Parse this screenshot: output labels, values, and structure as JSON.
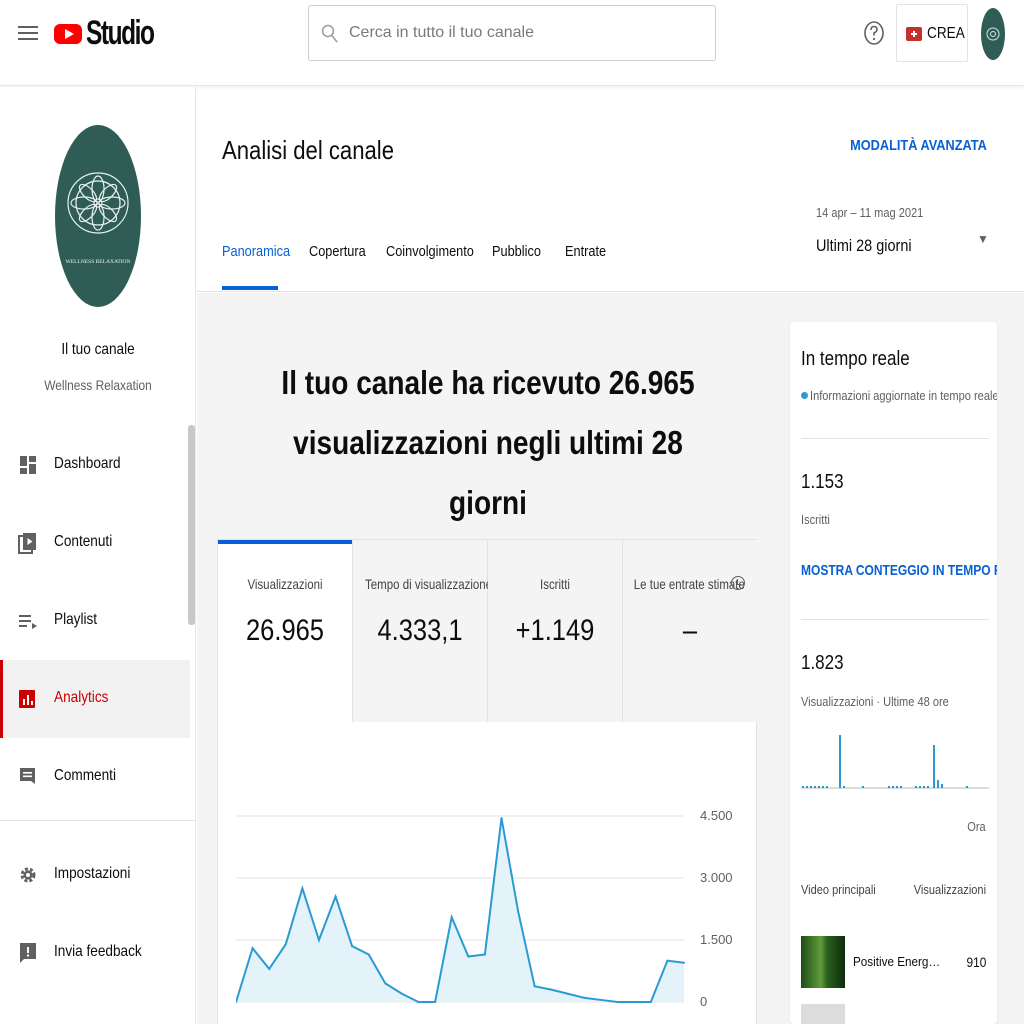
{
  "header": {
    "logo_text": "Studio",
    "search_placeholder": "Cerca in tutto il tuo canale",
    "create_label": "CREA"
  },
  "sidebar": {
    "channel_title": "Il tuo canale",
    "channel_name": "Wellness Relaxation",
    "avatar_text": "WELLNESS RELAXATION",
    "items": [
      {
        "label": "Dashboard",
        "icon": "dashboard-icon"
      },
      {
        "label": "Contenuti",
        "icon": "content-icon"
      },
      {
        "label": "Playlist",
        "icon": "playlist-icon"
      },
      {
        "label": "Analytics",
        "icon": "analytics-icon",
        "active": true
      },
      {
        "label": "Commenti",
        "icon": "comments-icon"
      }
    ],
    "bottom_items": [
      {
        "label": "Impostazioni",
        "icon": "gear-icon"
      },
      {
        "label": "Invia feedback",
        "icon": "feedback-icon"
      }
    ]
  },
  "main": {
    "title": "Analisi del canale",
    "advanced_link": "MODALITÀ AVANZATA",
    "tabs": [
      {
        "label": "Panoramica",
        "active": true
      },
      {
        "label": "Copertura"
      },
      {
        "label": "Coinvolgimento"
      },
      {
        "label": "Pubblico"
      },
      {
        "label": "Entrate"
      }
    ],
    "date_range": "14 apr – 11 mag 2021",
    "period_selected": "Ultimi 28 giorni",
    "headline": "Il tuo canale ha ricevuto 26.965 visualizzazioni negli ultimi 28 giorni",
    "metrics": [
      {
        "label": "Visualizzazioni",
        "value": "26.965",
        "selected": true
      },
      {
        "label": "Tempo di visualizzazione (ore)",
        "value": "4.333,1"
      },
      {
        "label": "Iscritti",
        "value": "+1.149"
      },
      {
        "label": "Le tue entrate stimate",
        "value": "–"
      }
    ]
  },
  "chart_data": {
    "type": "area",
    "series": [
      {
        "values": [
          0,
          1300,
          800,
          1400,
          2750,
          1500,
          2550,
          1350,
          1150,
          450,
          200,
          0,
          0,
          2050,
          1100,
          1150,
          4450,
          2200,
          380,
          300,
          200,
          100,
          50,
          0,
          0,
          0,
          1000,
          950
        ]
      }
    ],
    "ylim": [
      0,
      4500
    ],
    "yticks": [
      "4.500",
      "3.000",
      "1.500",
      "0"
    ],
    "color": "#2a9ad5"
  },
  "realtime": {
    "title": "In tempo reale",
    "subtitle": "Informazioni aggiornate in tempo reale",
    "subscribers_value": "1.153",
    "subscribers_label": "Iscritti",
    "show_live_link": "MOSTRA CONTEGGIO IN TEMPO REALE",
    "views_value": "1.823",
    "views_label": "Visualizzazioni · Ultime 48 ore",
    "hour_label": "Ora",
    "top_videos_header": "Video principali",
    "views_header": "Visualizzazioni",
    "top_video_title": "Positive Energy. Nat...",
    "top_video_views": "910"
  },
  "colors": {
    "accent_blue": "#065fd4",
    "active_red": "#cc0000",
    "chart_line": "#2a9ad5",
    "avatar_green": "#2f5d56"
  }
}
